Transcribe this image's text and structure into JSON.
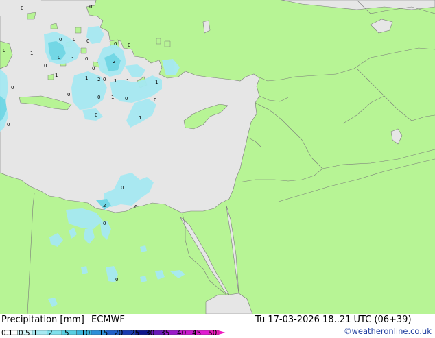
{
  "map": {
    "colors": {
      "land": "#b7f495",
      "sea": "#e6e6e6",
      "border": "#7a7a7a",
      "light_precip": "#a6e9f2",
      "medium_precip": "#6dd7e5"
    },
    "point_values": [
      {
        "v": "1"
      },
      {
        "v": "0"
      },
      {
        "v": "0"
      },
      {
        "v": "1"
      },
      {
        "v": "0"
      },
      {
        "v": "0"
      },
      {
        "v": "0"
      },
      {
        "v": "0"
      },
      {
        "v": "1"
      },
      {
        "v": "0"
      },
      {
        "v": "0"
      },
      {
        "v": "0"
      },
      {
        "v": "1"
      },
      {
        "v": "1"
      },
      {
        "v": "0"
      },
      {
        "v": "2"
      },
      {
        "v": "0"
      },
      {
        "v": "2"
      },
      {
        "v": "1"
      },
      {
        "v": "1"
      },
      {
        "v": "1"
      },
      {
        "v": "0"
      },
      {
        "v": "0"
      },
      {
        "v": "0"
      },
      {
        "v": "1"
      },
      {
        "v": "0"
      },
      {
        "v": "0"
      },
      {
        "v": "1"
      },
      {
        "v": "0"
      },
      {
        "v": "0"
      },
      {
        "v": "0"
      },
      {
        "v": "0"
      },
      {
        "v": "2"
      },
      {
        "v": "0"
      },
      {
        "v": "0"
      },
      {
        "v": "0"
      },
      {
        "v": "0"
      }
    ]
  },
  "footer": {
    "title": "Precipitation [mm]",
    "model": "ECMWF",
    "datetime": "Tu 17-03-2026 18..21 UTC (06+39)",
    "watermark": "©weatheronline.co.uk"
  },
  "legend": {
    "ticks": [
      "0.1",
      "0.5",
      "1",
      "2",
      "5",
      "10",
      "15",
      "20",
      "25",
      "30",
      "35",
      "40",
      "45",
      "50"
    ],
    "colors": [
      "#fefefe",
      "#d5f6fa",
      "#a6e9f2",
      "#80e0ec",
      "#58cfe2",
      "#3ab5dc",
      "#2d8fd8",
      "#2060c8",
      "#1a3ab0",
      "#10178c",
      "#6a18b8",
      "#9a1ac8",
      "#c81acc",
      "#e01ad0",
      "#f01ac0"
    ]
  }
}
